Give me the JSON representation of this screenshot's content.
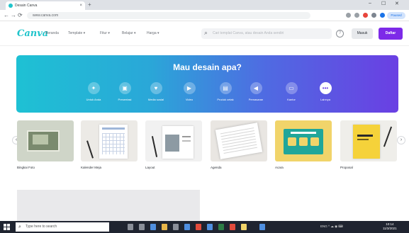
{
  "browser": {
    "tab_title": "Desain Canva",
    "tab_close": "×",
    "new_tab": "+",
    "url": "www.canva.com",
    "back": "←",
    "forward": "→",
    "reload": "⟳",
    "profile": "Paused",
    "window_controls": [
      "–",
      "☐",
      "✕"
    ]
  },
  "header": {
    "logo": "Canva",
    "nav": [
      "Beranda",
      "Template ▾",
      "Fitur ▾",
      "Belajar ▾",
      "Harga ▾"
    ],
    "search_placeholder": "Cari templat Canva, atau desain Anda sendiri",
    "help": "?",
    "secondary_button": "Masuk",
    "primary_button": "Daftar"
  },
  "hero": {
    "title": "Mau desain apa?",
    "categories": [
      {
        "label": "Untuk Anda",
        "icon": "sparkle-icon",
        "glyph": "✦"
      },
      {
        "label": "Presentasi",
        "icon": "presentation-icon",
        "glyph": "▣"
      },
      {
        "label": "Media sosial",
        "icon": "heart-icon",
        "glyph": "♥"
      },
      {
        "label": "Video",
        "icon": "video-icon",
        "glyph": "▶"
      },
      {
        "label": "Produk cetak",
        "icon": "print-icon",
        "glyph": "▤"
      },
      {
        "label": "Pemasaran",
        "icon": "megaphone-icon",
        "glyph": "◀"
      },
      {
        "label": "Kantor",
        "icon": "briefcase-icon",
        "glyph": "▭"
      },
      {
        "label": "Lainnya",
        "icon": "more-icon",
        "glyph": "•••"
      }
    ]
  },
  "templates": {
    "prev": "‹",
    "next": "›",
    "items": [
      {
        "name": "Bingkai Foto"
      },
      {
        "name": "Kalender Meja"
      },
      {
        "name": "Layout"
      },
      {
        "name": "Agenda"
      },
      {
        "name": "Acara"
      },
      {
        "name": "Proposal"
      }
    ]
  },
  "taskbar": {
    "search_placeholder": "Type here to search",
    "search_glyph": "⌕",
    "tray": "ENG ^ ☁ ◉ ⌨",
    "time": "10:14",
    "date": "11/3/2021"
  },
  "colors": {
    "accent": "#7d2ae8",
    "brand": "#20c4cb",
    "hero_start": "#1ec1d4",
    "hero_end": "#6a3fe3"
  }
}
